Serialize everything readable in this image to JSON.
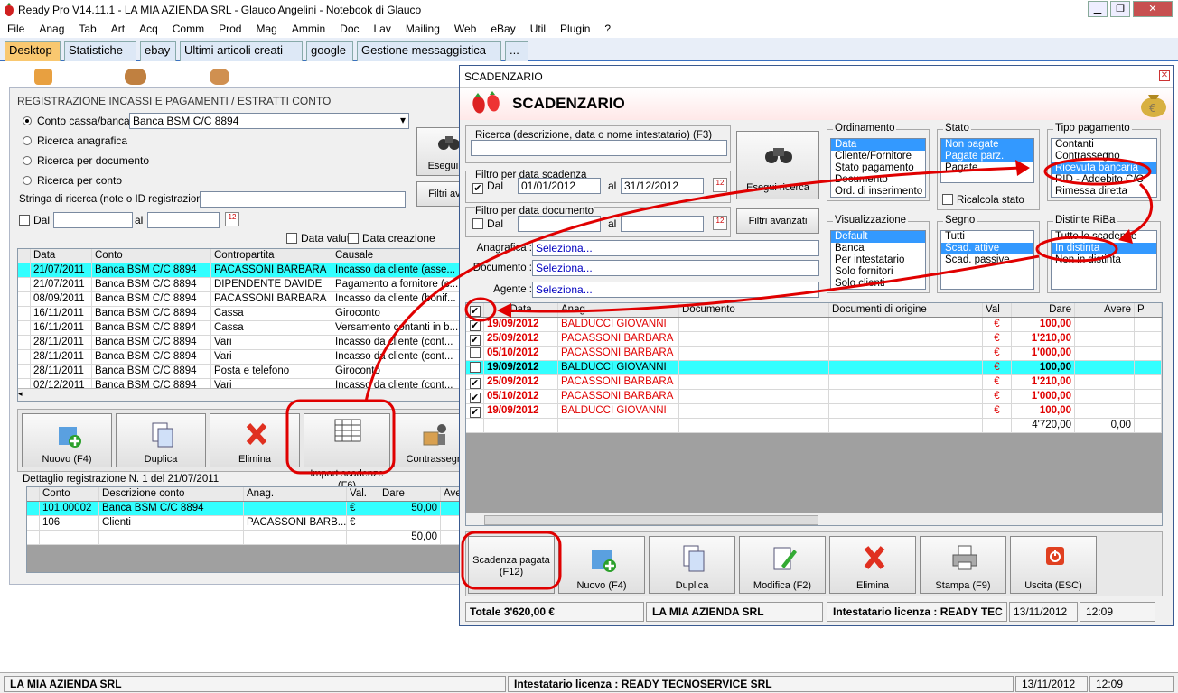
{
  "window": {
    "title": "Ready Pro V14.11.1 - LA MIA AZIENDA SRL - Glauco Angelini - Notebook di Glauco"
  },
  "menu": [
    "File",
    "Anag",
    "Tab",
    "Art",
    "Acq",
    "Comm",
    "Prod",
    "Mag",
    "Ammin",
    "Doc",
    "Lav",
    "Mailing",
    "Web",
    "eBay",
    "Util",
    "Plugin",
    "?"
  ],
  "tabs": [
    "Desktop",
    "Statistiche",
    "ebay",
    "Ultimi articoli creati",
    "google",
    "Gestione messaggistica",
    "..."
  ],
  "reg": {
    "title": "REGISTRAZIONE INCASSI E PAGAMENTI / ESTRATTI CONTO",
    "radio_conto": "Conto cassa/banca",
    "conto_value": "Banca BSM C/C 8894",
    "radio_anag": "Ricerca anagrafica",
    "radio_doc": "Ricerca per documento",
    "radio_conto2": "Ricerca per conto",
    "search_label": "Stringa di ricerca (note o ID registrazione)",
    "dal": "Dal",
    "al": "al",
    "data_valuta": "Data valuta",
    "data_creazione": "Data creazione",
    "esegui_btn": "Esegui ri",
    "filtri_btn": "Filtri ava",
    "cols": [
      "Data",
      "Conto",
      "Contropartita",
      "Causale"
    ],
    "rows": [
      [
        "21/07/2011",
        "Banca BSM C/C 8894",
        "PACASSONI BARBARA",
        "Incasso da cliente (asse..."
      ],
      [
        "21/07/2011",
        "Banca BSM C/C 8894",
        "DIPENDENTE DAVIDE",
        "Pagamento a fornitore (c..."
      ],
      [
        "08/09/2011",
        "Banca BSM C/C 8894",
        "PACASSONI BARBARA",
        "Incasso da cliente (bonif..."
      ],
      [
        "16/11/2011",
        "Banca BSM C/C 8894",
        "Cassa",
        "Giroconto"
      ],
      [
        "16/11/2011",
        "Banca BSM C/C 8894",
        "Cassa",
        "Versamento contanti in b..."
      ],
      [
        "28/11/2011",
        "Banca BSM C/C 8894",
        "Vari",
        "Incasso da cliente (cont..."
      ],
      [
        "28/11/2011",
        "Banca BSM C/C 8894",
        "Vari",
        "Incasso da cliente (cont..."
      ],
      [
        "28/11/2011",
        "Banca BSM C/C 8894",
        "Posta e telefono",
        "Giroconto"
      ],
      [
        "02/12/2011",
        "Banca BSM C/C 8894",
        "Vari",
        "Incasso da cliente (cont..."
      ]
    ],
    "buttons": [
      "Nuovo (F4)",
      "Duplica",
      "Elimina",
      "Import scadenze\n(F6)",
      "Contrassegni"
    ],
    "detail_title": "Dettaglio registrazione N. 1 del 21/07/2011",
    "detail_cols": [
      "Conto",
      "Descrizione conto",
      "Anag.",
      "Val.",
      "Dare",
      "Ave"
    ],
    "detail_rows": [
      [
        "101.00002",
        "Banca BSM C/C 8894",
        "",
        "€",
        "50,00",
        ""
      ],
      [
        "106",
        "Clienti",
        "PACASSONI BARB...",
        "€",
        "",
        ""
      ],
      [
        "",
        "",
        "",
        "",
        "50,00",
        ""
      ]
    ]
  },
  "scad": {
    "caption": "SCADENZARIO",
    "header": "SCADENZARIO",
    "ricerca_label": "Ricerca (descrizione, data o nome intestatario) (F3)",
    "filtro_scad_label": "Filtro per data scadenza",
    "dal": "Dal",
    "al": "al",
    "from_date": "01/01/2012",
    "to_date": "31/12/2012",
    "filtro_doc_label": "Filtro per data documento",
    "esegui": "Esegui ricerca",
    "filtri": "Filtri avanzati",
    "anagrafica_label": "Anagrafica :",
    "documento_label": "Documento :",
    "agente_label": "Agente :",
    "seleziona": "Seleziona...",
    "ordinamento_label": "Ordinamento",
    "ordinamento": [
      "Data",
      "Cliente/Fornitore",
      "Stato pagamento",
      "Documento",
      "Ord. di inserimento"
    ],
    "stato_label": "Stato",
    "stato": [
      "Non pagate",
      "Pagate parz.",
      "Pagate"
    ],
    "ricalcola": "Ricalcola stato",
    "tipo_label": "Tipo pagamento",
    "tipo": [
      "Contanti",
      "Contrassegno",
      "Ricevuta bancaria",
      "RID - Addebito C/C",
      "Rimessa diretta"
    ],
    "visual_label": "Visualizzazione",
    "visual": [
      "Default",
      "Banca",
      "Per intestatario",
      "Solo fornitori",
      "Solo clienti"
    ],
    "segno_label": "Segno",
    "segno": [
      "Tutti",
      "Scad. attive",
      "Scad. passive"
    ],
    "distinte_label": "Distinte RiBa",
    "distinte": [
      "Tutte le scadenze",
      "In distinta",
      "Non in distinta"
    ],
    "cols": [
      "Data",
      "Anag.",
      "Documento",
      "Documenti di origine",
      "Val",
      "Dare",
      "Avere",
      "P"
    ],
    "rows": [
      {
        "checked": true,
        "data": "19/09/2012",
        "anag": "BALDUCCI GIOVANNI",
        "val": "€",
        "dare": "100,00",
        "red": true
      },
      {
        "checked": true,
        "data": "25/09/2012",
        "anag": "PACASSONI BARBARA",
        "val": "€",
        "dare": "1'210,00",
        "red": true
      },
      {
        "checked": false,
        "data": "05/10/2012",
        "anag": "PACASSONI BARBARA",
        "val": "€",
        "dare": "1'000,00",
        "red": true
      },
      {
        "checked": false,
        "data": "19/09/2012",
        "anag": "BALDUCCI GIOVANNI",
        "val": "€",
        "dare": "100,00",
        "red": false,
        "sel": true
      },
      {
        "checked": true,
        "data": "25/09/2012",
        "anag": "PACASSONI BARBARA",
        "val": "€",
        "dare": "1'210,00",
        "red": true
      },
      {
        "checked": true,
        "data": "05/10/2012",
        "anag": "PACASSONI BARBARA",
        "val": "€",
        "dare": "1'000,00",
        "red": true
      },
      {
        "checked": true,
        "data": "19/09/2012",
        "anag": "BALDUCCI GIOVANNI",
        "val": "€",
        "dare": "100,00",
        "red": true
      }
    ],
    "total_dare": "4'720,00",
    "total_avere": "0,00",
    "buttons": [
      "Scadenza pagata\n(F12)",
      "Nuovo (F4)",
      "Duplica",
      "Modifica (F2)",
      "Elimina",
      "Stampa (F9)",
      "Uscita (ESC)"
    ],
    "status": {
      "totale": "Totale 3'620,00 €",
      "azienda": "LA MIA AZIENDA SRL",
      "licenza": "Intestatario licenza : READY TEC",
      "data": "13/11/2012",
      "ora": "12:09"
    }
  },
  "statusbar": {
    "azienda": "LA MIA AZIENDA SRL",
    "licenza": "Intestatario licenza : READY TECNOSERVICE SRL",
    "data": "13/11/2012",
    "ora": "12:09"
  },
  "colors": {
    "annotation": "#e00000",
    "selection": "#33ffff",
    "highlight": "#3399ff",
    "active_tab": "#f9c870"
  }
}
